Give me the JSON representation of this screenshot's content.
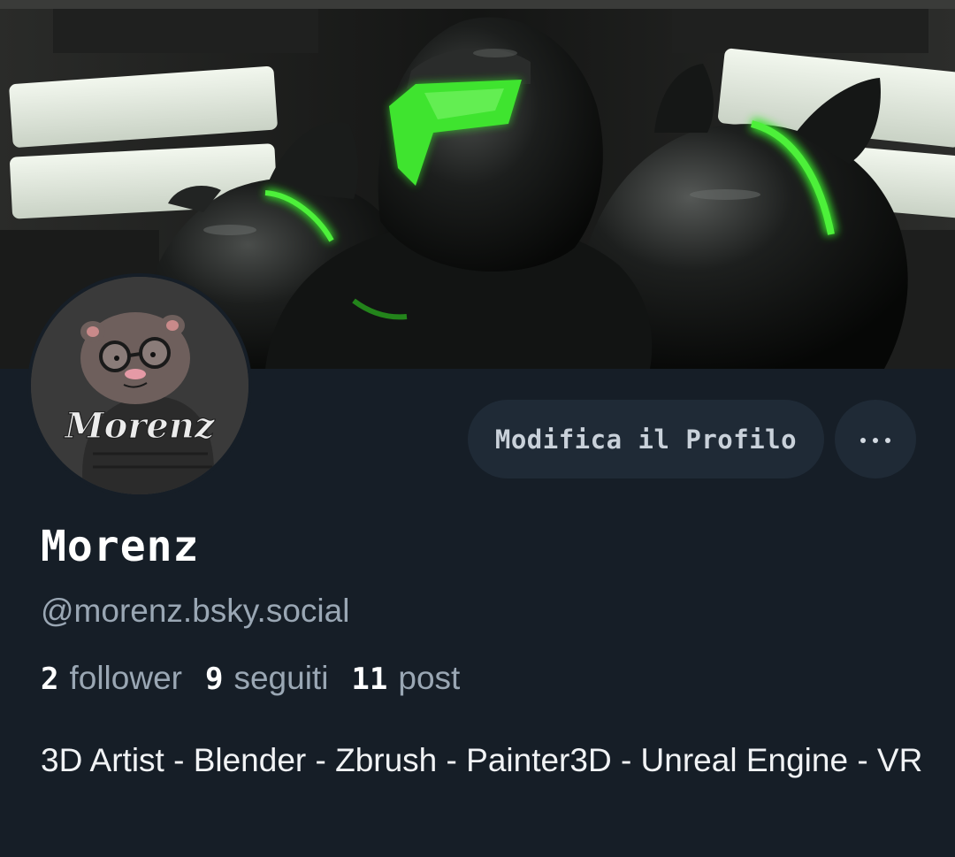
{
  "profile": {
    "display_name": "Morenz",
    "handle": "@morenz.bsky.social",
    "avatar_text": "Morenz",
    "stats": [
      {
        "value": "2",
        "label": "follower"
      },
      {
        "value": "9",
        "label": "seguiti"
      },
      {
        "value": "11",
        "label": "post"
      }
    ],
    "bio": "3D Artist - Blender - Zbrush - Painter3D - Unreal Engine - VR"
  },
  "actions": {
    "edit_label": "Modifica il Profilo",
    "more_icon": "ellipsis-icon"
  },
  "colors": {
    "background": "#161e27",
    "button_bg": "#1f2a36",
    "muted_text": "#9aa7b4",
    "accent_green": "#39e62a"
  }
}
